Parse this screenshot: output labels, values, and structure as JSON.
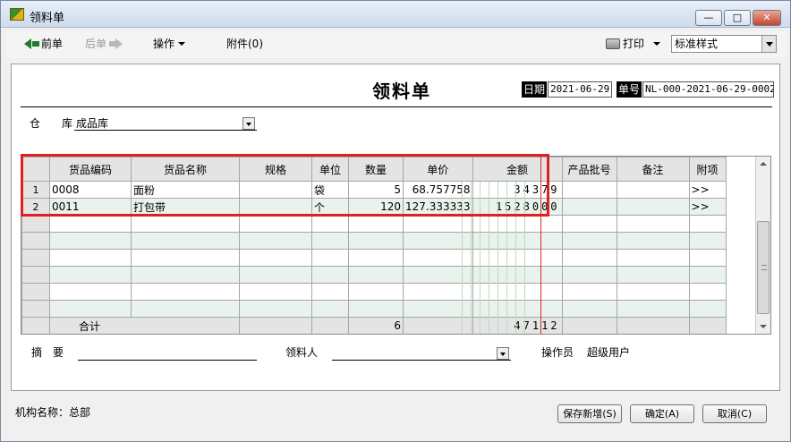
{
  "window": {
    "title": "领料单"
  },
  "toolbar": {
    "prev": "前单",
    "next": "后单",
    "actions": "操作",
    "attachments": "附件(0)",
    "print": "打印",
    "style_value": "标准样式"
  },
  "doc": {
    "title": "领料单",
    "date_label": "日期",
    "date_value": "2021-06-29",
    "number_label": "单号",
    "number_value": "NL-000-2021-06-29-0002",
    "warehouse_label": "仓　　库",
    "warehouse_value": "成品库",
    "summary_label": "摘　要",
    "requester_label": "领料人",
    "operator_label": "操作员",
    "operator_value": "超级用户"
  },
  "grid": {
    "columns": [
      "货品编码",
      "货品名称",
      "规格",
      "单位",
      "数量",
      "单价",
      "金额",
      "产品批号",
      "备注",
      "附项"
    ],
    "rows": [
      {
        "no": "1",
        "code": "0008",
        "name": "面粉",
        "spec": "",
        "unit": "袋",
        "qty": "5",
        "price": "68.757758",
        "amount": "34379",
        "batch": "",
        "note": "",
        "extra": ">>"
      },
      {
        "no": "2",
        "code": "0011",
        "name": "打包带",
        "spec": "",
        "unit": "个",
        "qty": "120",
        "price": "127.333333",
        "amount": "1528000",
        "batch": "",
        "note": "",
        "extra": ">>"
      }
    ],
    "total": {
      "label": "合计",
      "qty": "6",
      "amount": "47112"
    }
  },
  "footer": {
    "org": "机构名称：总部",
    "save_new": "保存新增(S)",
    "ok": "确定(A)",
    "cancel": "取消(C)"
  },
  "colors": {
    "highlight": "#e02020",
    "title_gradient": "#dbe6f3",
    "alt_row": "#e9f2ec"
  }
}
